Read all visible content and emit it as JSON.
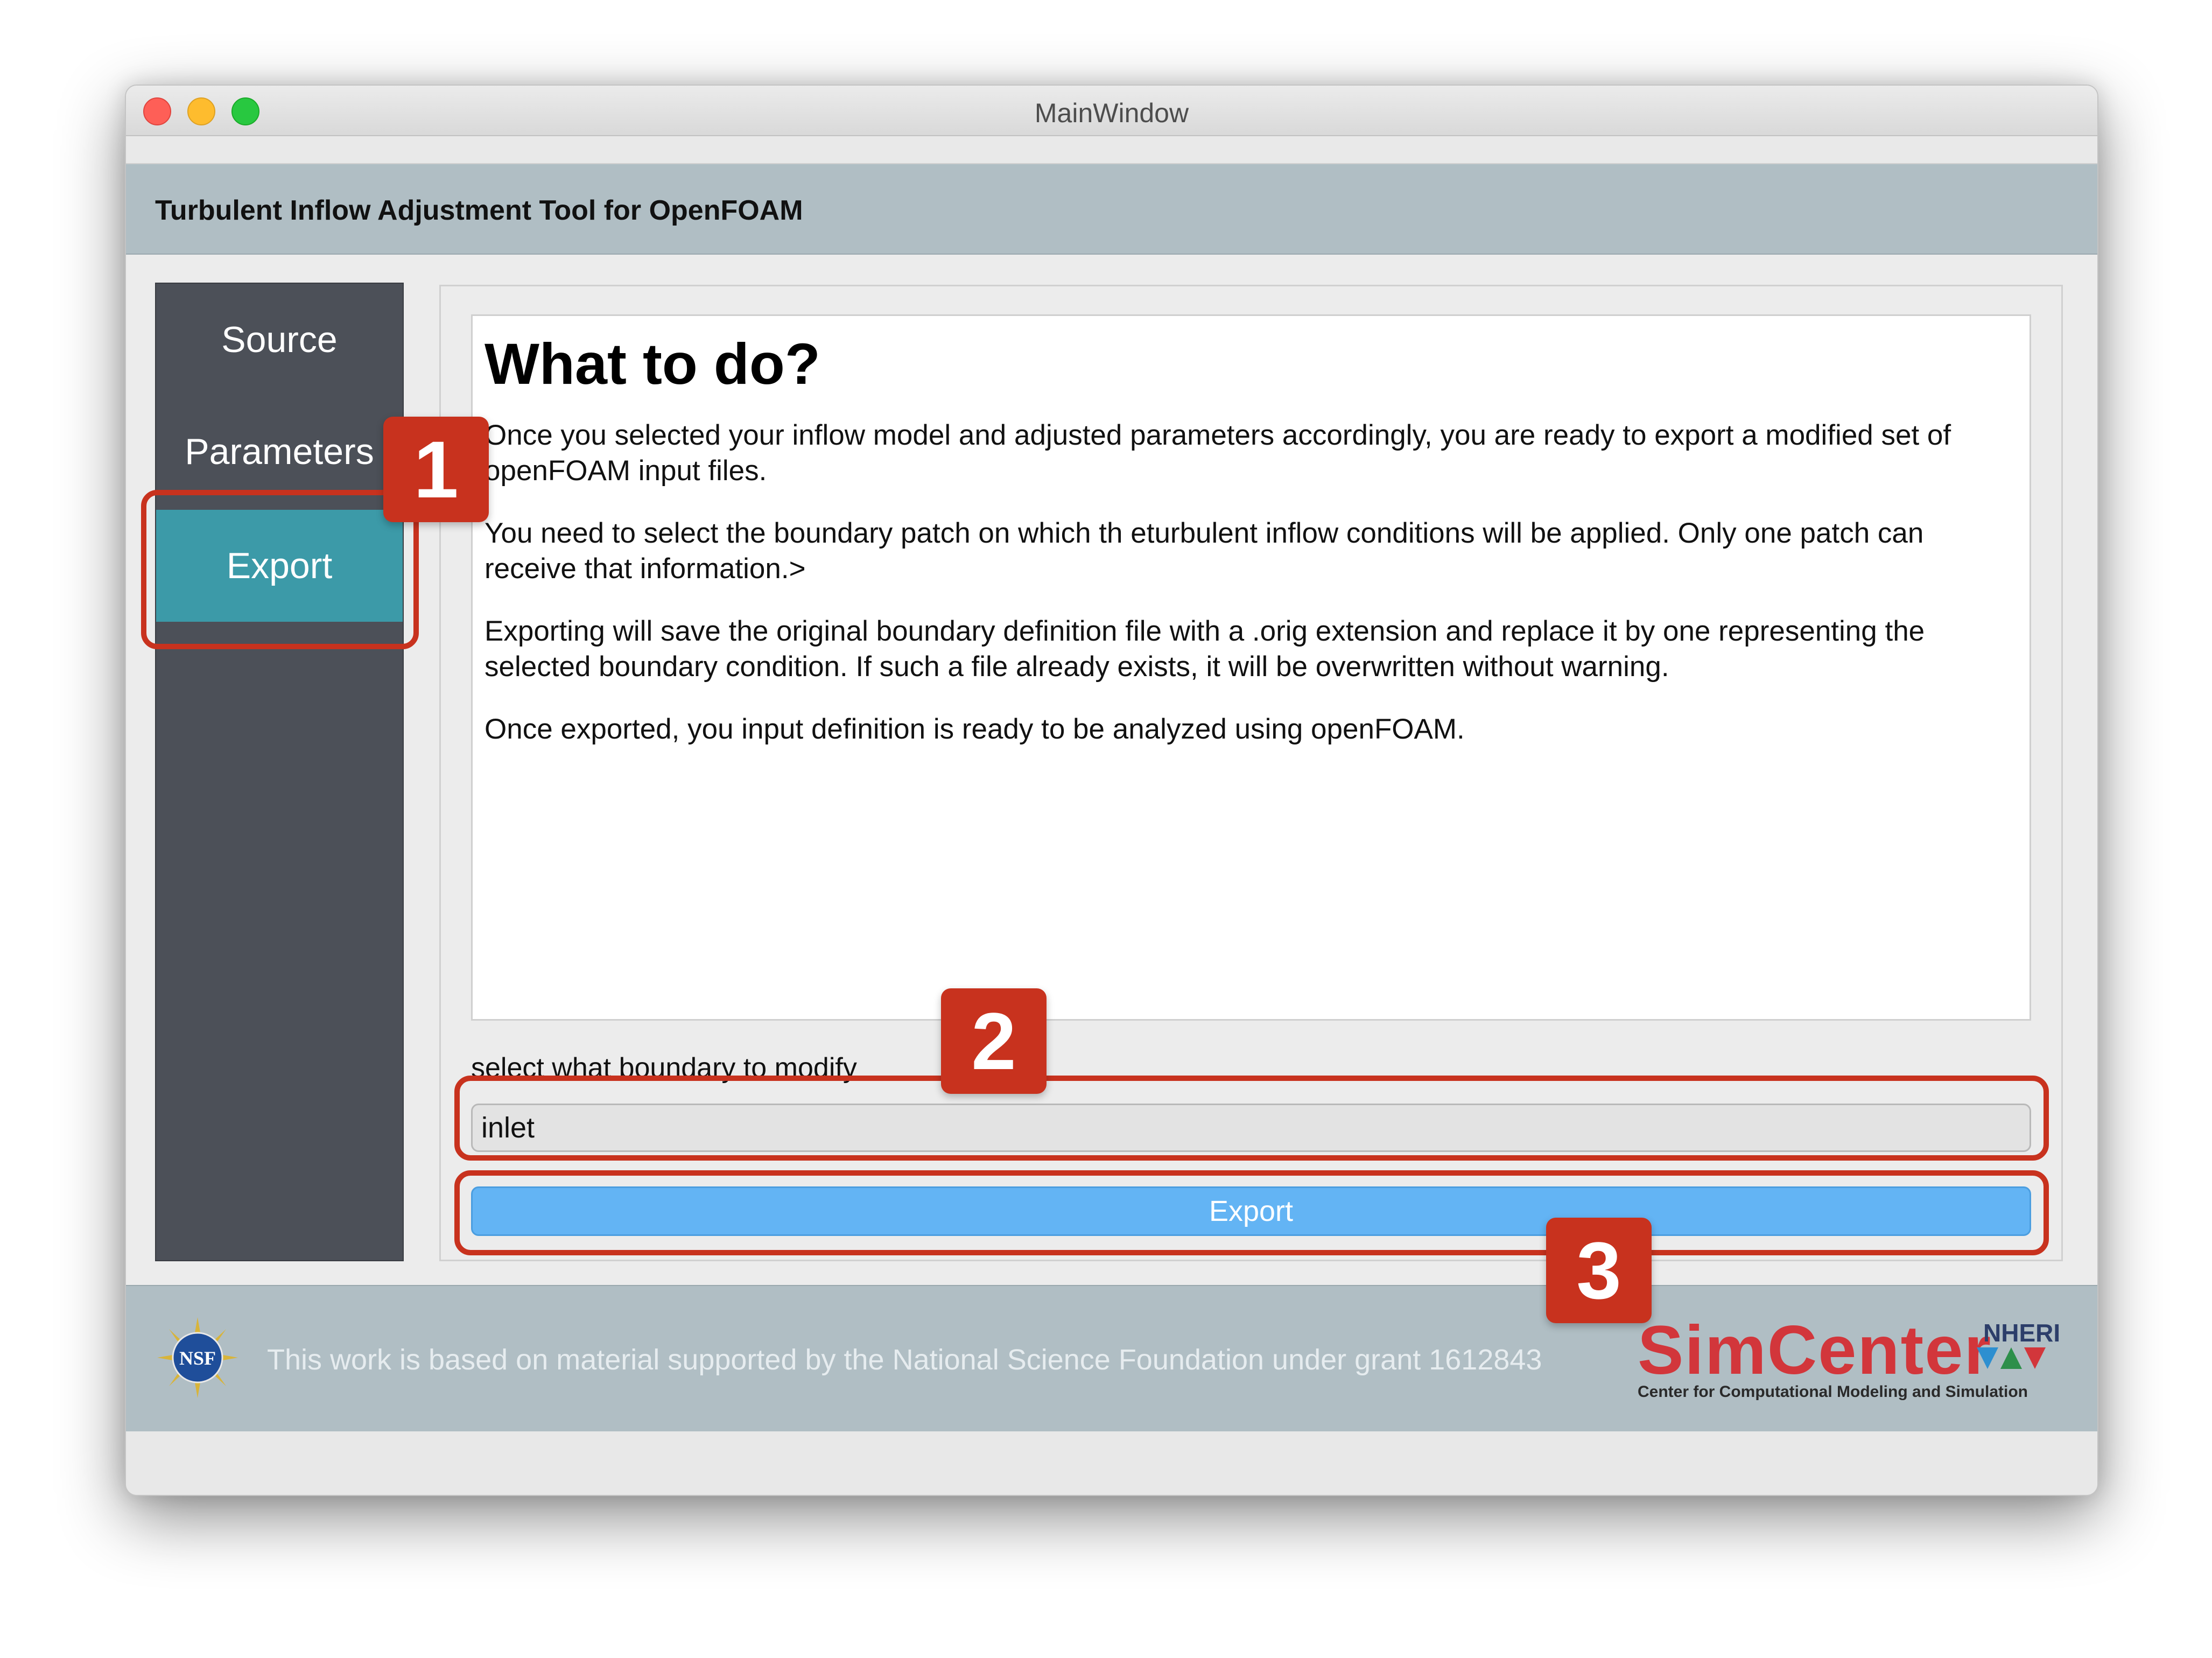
{
  "window": {
    "title": "MainWindow"
  },
  "header": {
    "app_title": "Turbulent Inflow Adjustment Tool for OpenFOAM"
  },
  "sidebar": {
    "items": [
      {
        "label": "Source",
        "active": false
      },
      {
        "label": "Parameters",
        "active": false
      },
      {
        "label": "Export",
        "active": true
      }
    ]
  },
  "main": {
    "heading": "What to do?",
    "paragraphs": [
      "Once you selected your inflow model and adjusted parameters accordingly, you are ready to export a modified set of openFOAM input files.",
      "You need to select the boundary patch on which th eturbulent inflow conditions will be applied. Only one patch can receive that information.>",
      "Exporting will save the original boundary definition file with a .orig extension and replace it by one representing the selected boundary condition. If such a file already exists, it will be overwritten without warning.",
      "Once exported, you input definition is ready to be analyzed using openFOAM."
    ],
    "select_label": "select what boundary to modify",
    "select_value": "inlet",
    "export_button": "Export"
  },
  "footer": {
    "nsf_logo_text": "NSF",
    "text": "This work is based on material supported by the National Science Foundation under grant 1612843",
    "logo_name": "SimCenter",
    "logo_badge": "NHERI",
    "logo_subtitle": "Center for Computational Modeling and Simulation"
  },
  "annotations": {
    "badges": [
      "1",
      "2",
      "3"
    ],
    "color": "#c8321e"
  },
  "colors": {
    "sidebar_bg": "#4c5058",
    "sidebar_active": "#3c9aa8",
    "header_bg": "#b0bec4",
    "export_button": "#63b4f4",
    "simcenter_red": "#d2363b"
  }
}
